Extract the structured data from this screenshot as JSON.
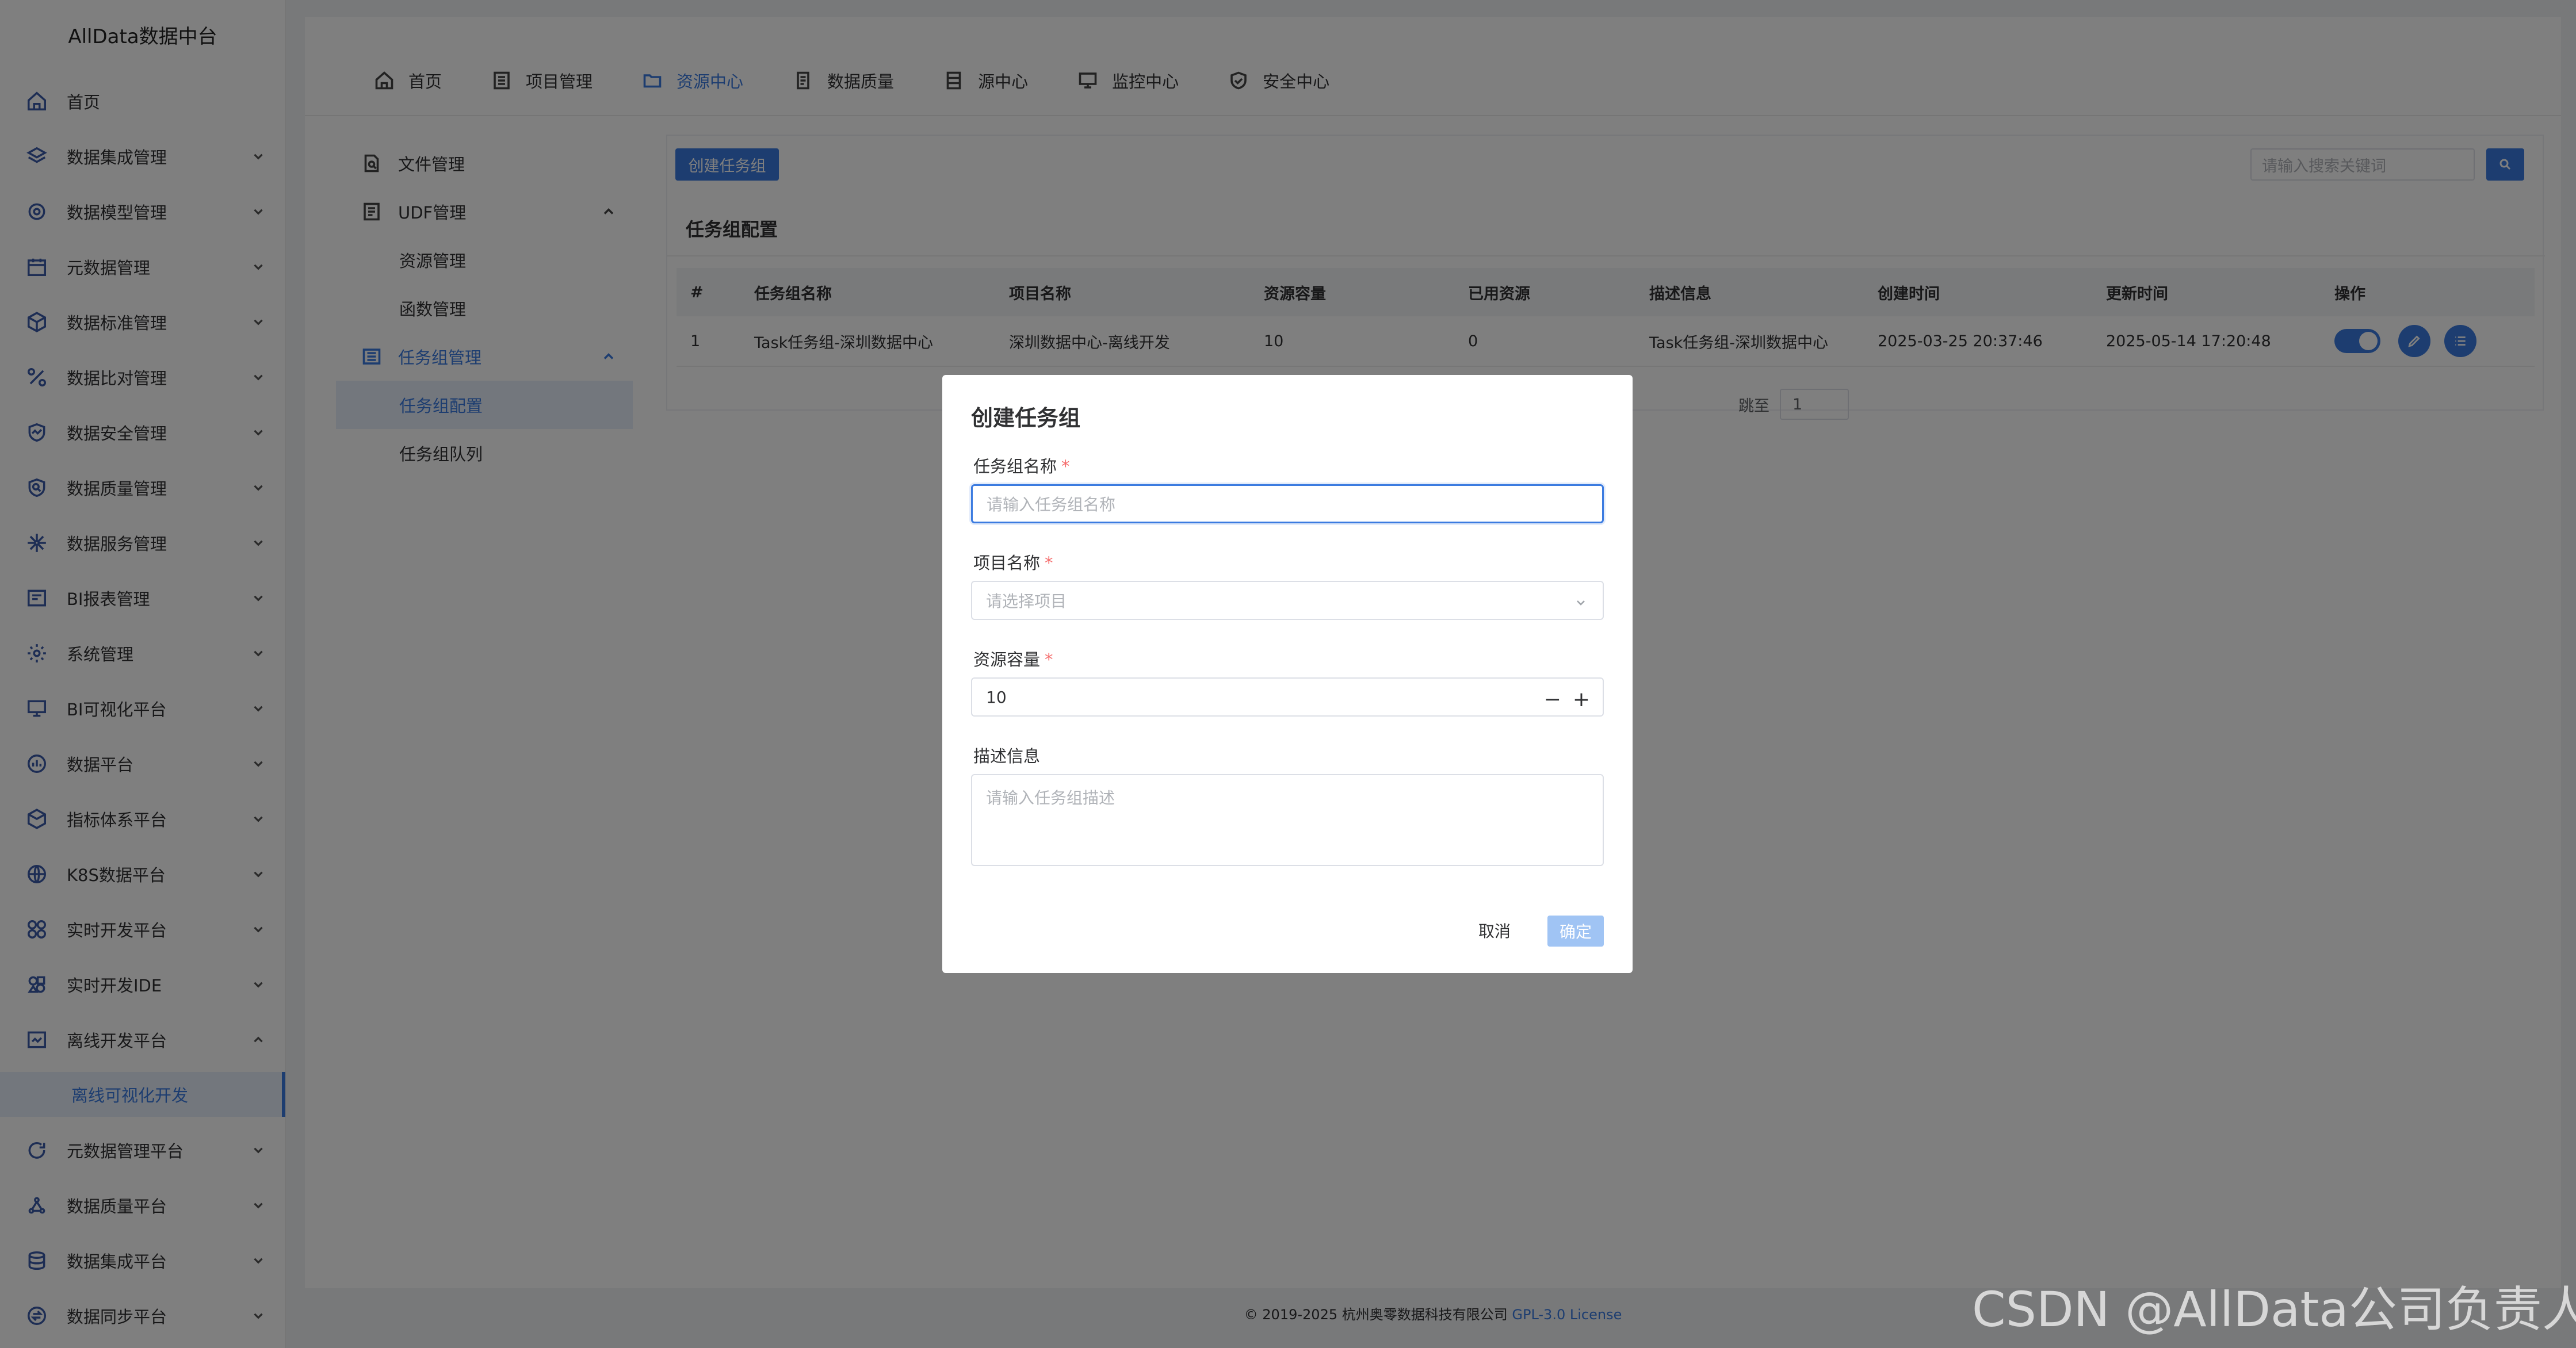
{
  "app_title": "AllData数据中台",
  "sidebar": {
    "items": [
      {
        "label": "首页",
        "icon": "home-icon",
        "chevron": false
      },
      {
        "label": "数据集成管理",
        "icon": "layers-icon",
        "chevron": true
      },
      {
        "label": "数据模型管理",
        "icon": "model-icon",
        "chevron": true
      },
      {
        "label": "元数据管理",
        "icon": "calendar-icon",
        "chevron": true
      },
      {
        "label": "数据标准管理",
        "icon": "cube-icon",
        "chevron": true
      },
      {
        "label": "数据比对管理",
        "icon": "percent-icon",
        "chevron": true
      },
      {
        "label": "数据安全管理",
        "icon": "shield-icon",
        "chevron": true
      },
      {
        "label": "数据质量管理",
        "icon": "search-shield-icon",
        "chevron": true
      },
      {
        "label": "数据服务管理",
        "icon": "network-icon",
        "chevron": true
      },
      {
        "label": "BI报表管理",
        "icon": "report-icon",
        "chevron": true
      },
      {
        "label": "系统管理",
        "icon": "gear-icon",
        "chevron": true
      },
      {
        "label": "BI可视化平台",
        "icon": "monitor-icon",
        "chevron": true
      },
      {
        "label": "数据平台",
        "icon": "chart-icon",
        "chevron": true
      },
      {
        "label": "指标体系平台",
        "icon": "box-icon",
        "chevron": true
      },
      {
        "label": "K8S数据平台",
        "icon": "globe-icon",
        "chevron": true
      },
      {
        "label": "实时开发平台",
        "icon": "grid-icon",
        "chevron": true
      },
      {
        "label": "实时开发IDE",
        "icon": "ide-icon",
        "chevron": true
      },
      {
        "label": "离线开发平台",
        "icon": "offline-icon",
        "chevron": true,
        "open": true
      },
      {
        "label": "元数据管理平台",
        "icon": "sync-icon",
        "chevron": true
      },
      {
        "label": "数据质量平台",
        "icon": "nodes-icon",
        "chevron": true
      },
      {
        "label": "数据集成平台",
        "icon": "database-icon",
        "chevron": true
      },
      {
        "label": "数据同步平台",
        "icon": "swap-icon",
        "chevron": true
      }
    ],
    "active_sub": "离线可视化开发"
  },
  "topnav": {
    "items": [
      {
        "label": "首页",
        "icon": "home-icon"
      },
      {
        "label": "项目管理",
        "icon": "list-icon"
      },
      {
        "label": "资源中心",
        "icon": "folder-icon",
        "active": true
      },
      {
        "label": "数据质量",
        "icon": "document-icon"
      },
      {
        "label": "源中心",
        "icon": "server-icon"
      },
      {
        "label": "监控中心",
        "icon": "monitor-icon"
      },
      {
        "label": "安全中心",
        "icon": "shield-check-icon"
      }
    ]
  },
  "submenu": {
    "file": "文件管理",
    "udf": "UDF管理",
    "udf_children": [
      "资源管理",
      "函数管理"
    ],
    "taskgroup": "任务组管理",
    "taskgroup_children": [
      "任务组配置",
      "任务组队列"
    ]
  },
  "content": {
    "create_button": "创建任务组",
    "search_placeholder": "请输入搜索关键词",
    "card_title": "任务组配置",
    "columns": [
      "#",
      "任务组名称",
      "项目名称",
      "资源容量",
      "已用资源",
      "描述信息",
      "创建时间",
      "更新时间",
      "操作"
    ],
    "rows": [
      [
        "1",
        "Task任务组-深圳数据中心",
        "深圳数据中心-离线开发",
        "10",
        "0",
        "Task任务组-深圳数据中心",
        "2025-03-25 20:37:46",
        "2025-05-14 17:20:48"
      ]
    ],
    "jump_label": "跳至",
    "jump_value": "1"
  },
  "footer": {
    "copyright": "© 2019-2025 杭州奥零数据科技有限公司",
    "license": "GPL-3.0 License"
  },
  "modal": {
    "title": "创建任务组",
    "name_label": "任务组名称",
    "name_placeholder": "请输入任务组名称",
    "project_label": "项目名称",
    "project_placeholder": "请选择项目",
    "capacity_label": "资源容量",
    "capacity_value": "10",
    "desc_label": "描述信息",
    "desc_placeholder": "请输入任务组描述",
    "required_mark": "*",
    "cancel": "取消",
    "ok": "确定"
  },
  "watermark": "CSDN @AllData公司负责人",
  "colors": {
    "primary": "#3b7be0",
    "required": "#f56c6c",
    "ok_disabled": "#a0c4f4"
  }
}
